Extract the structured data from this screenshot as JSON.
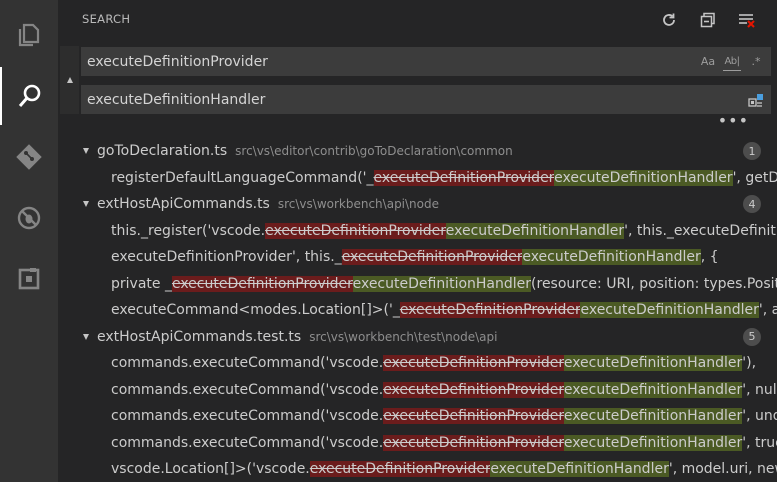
{
  "activity_bar": {
    "items": [
      {
        "name": "explorer-icon"
      },
      {
        "name": "search-icon"
      },
      {
        "name": "source-control-icon"
      },
      {
        "name": "debug-icon"
      },
      {
        "name": "extensions-icon"
      }
    ]
  },
  "search": {
    "header_title": "SEARCH",
    "header_actions": [
      "refresh-icon",
      "collapse-all-icon",
      "clear-results-icon"
    ],
    "find_value": "executeDefinitionProvider",
    "replace_value": "executeDefinitionHandler",
    "find_options": [
      "Aa",
      "Ab|",
      ".*"
    ],
    "replace_options": [
      "replace-all-icon"
    ],
    "more_label": "•••"
  },
  "results": [
    {
      "file": "goToDeclaration.ts",
      "path": "src\\vs\\editor\\contrib\\goToDeclaration\\common",
      "count": "1",
      "matches": [
        {
          "pre": "registerDefaultLanguageCommand('_",
          "old": "executeDefinitionProvider",
          "new": "executeDefinitionHandler",
          "post": "', getD..."
        }
      ]
    },
    {
      "file": "extHostApiCommands.ts",
      "path": "src\\vs\\workbench\\api\\node",
      "count": "4",
      "matches": [
        {
          "pre": "this._register('vscode.",
          "old": "executeDefinitionProvider",
          "new": "executeDefinitionHandler",
          "post": "', this._executeDefinitio..."
        },
        {
          "pre": "executeDefinitionProvider', this._",
          "old": "executeDefinitionProvider",
          "new": "executeDefinitionHandler",
          "post": ", {"
        },
        {
          "pre": "private _",
          "old": "executeDefinitionProvider",
          "new": "executeDefinitionHandler",
          "post": "(resource: URI, position: types.Positi..."
        },
        {
          "pre": "executeCommand<modes.Location[]>('_",
          "old": "executeDefinitionProvider",
          "new": "executeDefinitionHandler",
          "post": "', ar..."
        }
      ]
    },
    {
      "file": "extHostApiCommands.test.ts",
      "path": "src\\vs\\workbench\\test\\node\\api",
      "count": "5",
      "matches": [
        {
          "pre": "commands.executeCommand('vscode.",
          "old": "executeDefinitionProvider",
          "new": "executeDefinitionHandler",
          "post": "'),"
        },
        {
          "pre": "commands.executeCommand('vscode.",
          "old": "executeDefinitionProvider",
          "new": "executeDefinitionHandler",
          "post": "', null),"
        },
        {
          "pre": "commands.executeCommand('vscode.",
          "old": "executeDefinitionProvider",
          "new": "executeDefinitionHandler",
          "post": "', und..."
        },
        {
          "pre": "commands.executeCommand('vscode.",
          "old": "executeDefinitionProvider",
          "new": "executeDefinitionHandler",
          "post": "', true..."
        },
        {
          "pre": "vscode.Location[]>('vscode.",
          "old": "executeDefinitionProvider",
          "new": "executeDefinitionHandler",
          "post": "', model.uri, new..."
        }
      ]
    }
  ]
}
